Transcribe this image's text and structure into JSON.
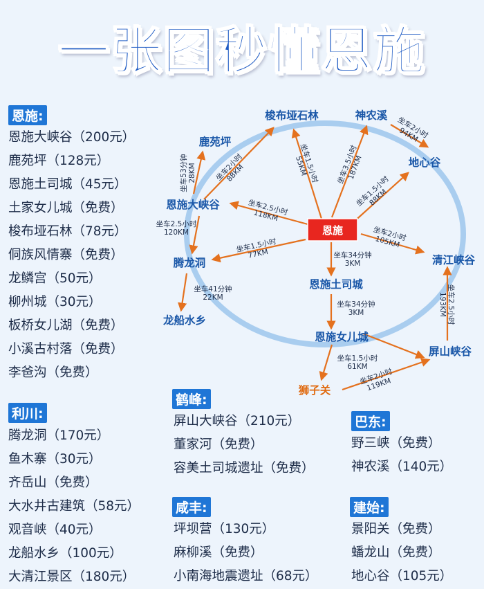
{
  "title": "一张图秒懂恩施",
  "colors": {
    "tag_bg": "#1f76d6",
    "arrow": "#e4711e",
    "ring": "#a9cdef",
    "hub_bg": "#e8261f",
    "title": "#1e5bc4"
  },
  "enshi": {
    "tag": "恩施:",
    "items": [
      "恩施大峡谷（200元）",
      "鹿苑坪（128元）",
      "恩施土司城（45元）",
      "土家女儿城（免费）",
      "梭布垭石林（78元）",
      "侗族风情寨（免费）",
      "龙鳞宫（50元）",
      "柳州城（30元）",
      "板桥女儿湖（免费）",
      "小溪古村落（免费）",
      "李爸沟（免费）"
    ]
  },
  "lichuan": {
    "tag": "利川:",
    "items": [
      "腾龙洞（170元）",
      "鱼木寨（30元）",
      "齐岳山（免费）",
      "大水井古建筑（58元）",
      "观音峡（40元）",
      "龙船水乡（100元）",
      "大清江景区（180元）"
    ]
  },
  "hefeng": {
    "tag": "鹤峰:",
    "items": [
      "屏山大峡谷（210元）",
      "董家河（免费）",
      "容美土司城遗址（免费）"
    ]
  },
  "xianfeng": {
    "tag": "咸丰:",
    "items": [
      "坪坝营（130元）",
      "麻柳溪（免费）",
      "小南海地震遗址（68元）"
    ]
  },
  "badong": {
    "tag": "巴东:",
    "items": [
      "野三峡（免费）",
      "神农溪（140元）"
    ]
  },
  "jianshi": {
    "tag": "建始:",
    "items": [
      "景阳关（免费）",
      "蟠龙山（免费）",
      "地心谷（105元）"
    ]
  },
  "map": {
    "hub": "恩施",
    "nodes": {
      "suobuya": "梭布垭石林",
      "shennongxi": "神农溪",
      "luyuanping": "鹿苑坪",
      "dixingu": "地心谷",
      "daxiagu": "恩施大峡谷",
      "qingjiang": "清江峡谷",
      "tenglong": "腾龙洞",
      "tusicheng": "恩施土司城",
      "longchuan": "龙船水乡",
      "nvercheng": "恩施女儿城",
      "pingshan": "屏山峡谷",
      "shiziguan": "狮子关"
    },
    "edges": {
      "hub_suobuya": [
        "坐车1.5小时",
        "55KM"
      ],
      "hub_shennongxi": [
        "坐车3.5小时",
        "187KM"
      ],
      "shennongxi_dixingu": [
        "坐车2小时",
        "94KM"
      ],
      "hub_dixingu": [
        "坐车1.5小时",
        "88KM"
      ],
      "daxiagu_suobuya": [
        "坐车2小时",
        "88KM"
      ],
      "daxiagu_luyuanping": [
        "坐车53分钟",
        "28KM"
      ],
      "hub_daxiagu": [
        "坐车2.5小时",
        "118KM"
      ],
      "daxiagu_tenglong": [
        "坐车2.5小时",
        "120KM"
      ],
      "hub_tenglong": [
        "坐车1.5小时",
        "77KM"
      ],
      "hub_qingjiang": [
        "坐车2小时",
        "105KM"
      ],
      "hub_tusicheng": [
        "坐车34分钟",
        "3KM"
      ],
      "tenglong_longchuan": [
        "坐车41分钟",
        "22KM"
      ],
      "tusicheng_nvercheng": [
        "坐车34分钟",
        "3KM"
      ],
      "pingshan_qingjiang": [
        "坐车2.5小时",
        "193KM"
      ],
      "nvercheng_pingshan": [
        "坐车1.5小时",
        "61KM"
      ],
      "shiziguan_pingshan": [
        "坐车2小时",
        "119KM"
      ]
    }
  }
}
